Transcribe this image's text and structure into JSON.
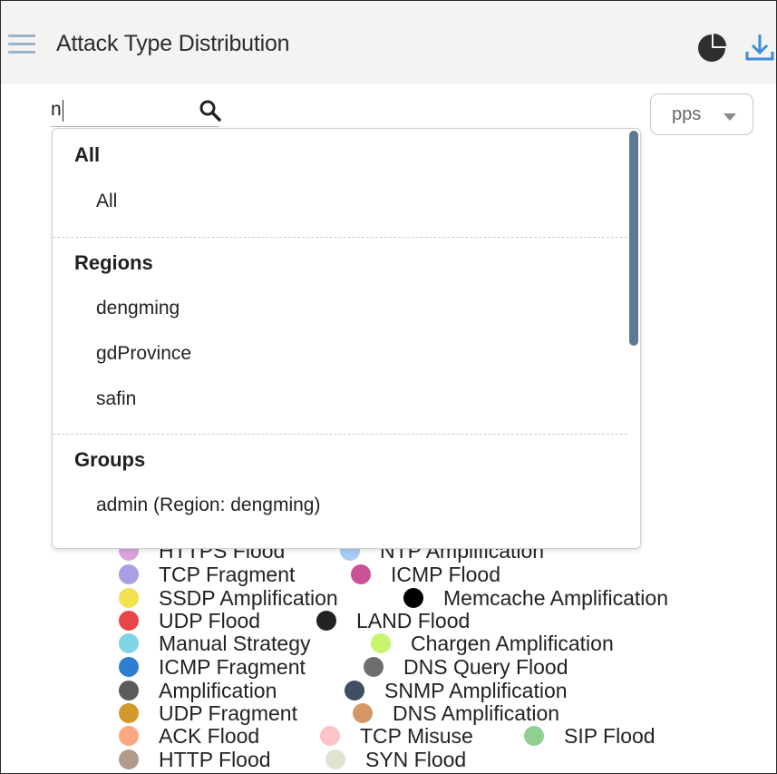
{
  "header": {
    "title": "Attack Type Distribution",
    "menu_icon": "hamburger-menu-icon",
    "chart_icon": "pie-chart-icon",
    "download_icon": "download-icon"
  },
  "search": {
    "value": "n",
    "icon": "search-icon"
  },
  "unit_select": {
    "value": "pps",
    "icon": "caret-down-icon"
  },
  "dropdown": {
    "groups": [
      {
        "heading": "All",
        "options": [
          "All"
        ]
      },
      {
        "heading": "Regions",
        "options": [
          "dengming",
          "gdProvince",
          "safin"
        ]
      },
      {
        "heading": "Groups",
        "options": [
          "admin (Region: dengming)"
        ]
      }
    ]
  },
  "legend": {
    "items": [
      {
        "label": "HTTPS Flood",
        "color": "#d9a4dc"
      },
      {
        "label": "NTP Amplification",
        "color": "#a9cdf7"
      },
      {
        "label": "TCP Fragment",
        "color": "#a99fe3"
      },
      {
        "label": "ICMP Flood",
        "color": "#c95299"
      },
      {
        "label": "SSDP Amplification",
        "color": "#f4e14f"
      },
      {
        "label": "Memcache Amplification",
        "color": "#000000"
      },
      {
        "label": "UDP Flood",
        "color": "#e84646"
      },
      {
        "label": "LAND Flood",
        "color": "#222222"
      },
      {
        "label": "Manual Strategy",
        "color": "#7fd4e6"
      },
      {
        "label": "Chargen Amplification",
        "color": "#c7f56b"
      },
      {
        "label": "ICMP Fragment",
        "color": "#2f7dcf"
      },
      {
        "label": "DNS Query Flood",
        "color": "#6e6e6e"
      },
      {
        "label": "Amplification",
        "color": "#5b5b5b"
      },
      {
        "label": "SNMP Amplification",
        "color": "#3f4e63"
      },
      {
        "label": "UDP Fragment",
        "color": "#d4992e"
      },
      {
        "label": "DNS Amplification",
        "color": "#d39868"
      },
      {
        "label": "ACK Flood",
        "color": "#fca783"
      },
      {
        "label": "TCP Misuse",
        "color": "#fcc4c8"
      },
      {
        "label": "SIP Flood",
        "color": "#8fcf8f"
      },
      {
        "label": "HTTP Flood",
        "color": "#b29b8a"
      },
      {
        "label": "SYN Flood",
        "color": "#dfe3d0"
      }
    ]
  }
}
